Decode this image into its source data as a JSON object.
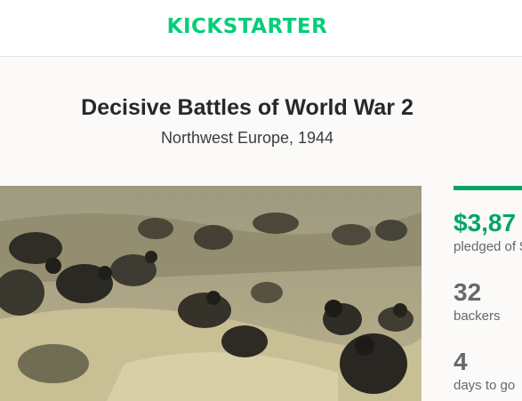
{
  "header": {
    "logo_text": "KICKSTARTER",
    "brand_color": "#05ce78"
  },
  "project": {
    "title": "Decisive Battles of World War 2",
    "subtitle": "Northwest Europe, 1944"
  },
  "video": {
    "description_icon": "video-thumbnail"
  },
  "stats": {
    "accent_color": "#05a565",
    "pledged_amount": "$3,87",
    "pledged_label": "pledged of $",
    "backers_count": "32",
    "backers_label": "backers",
    "days_count": "4",
    "days_label": "days to go"
  }
}
